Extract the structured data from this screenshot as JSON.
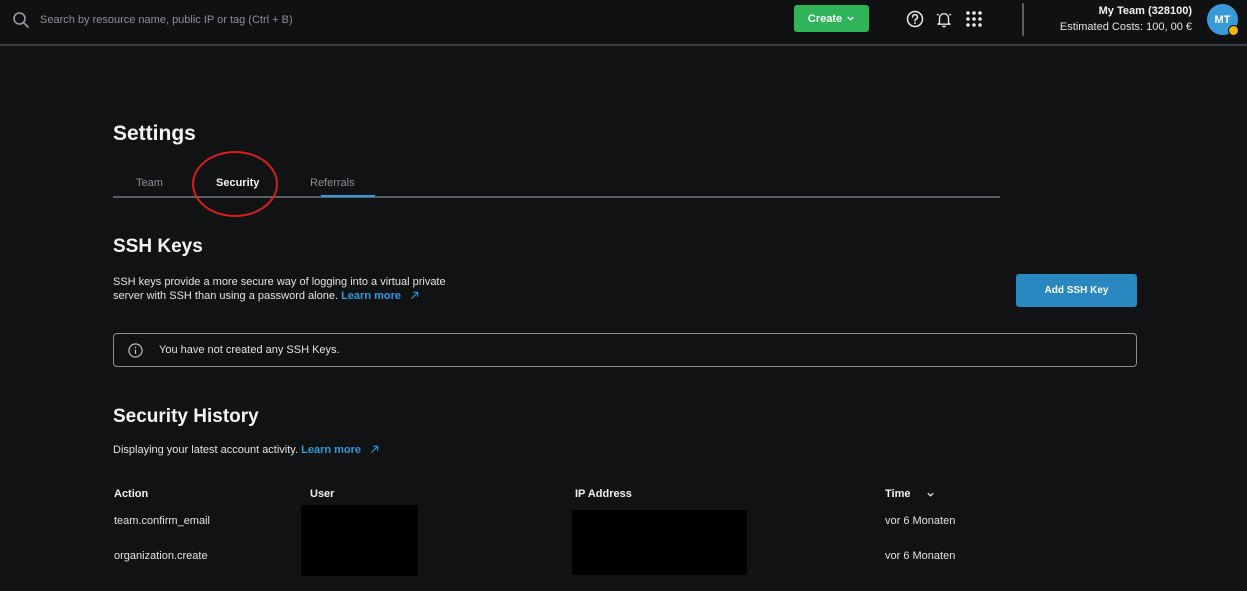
{
  "topbar": {
    "search_placeholder": "Search by resource name, public IP or tag (Ctrl + B)",
    "create_label": "Create",
    "icons": [
      "search-icon",
      "help-icon",
      "bell-icon",
      "apps-grid-icon",
      "chevron-down-icon"
    ],
    "team_name": "My Team (328100)",
    "estimated_costs": "Estimated Costs: 100, 00 €",
    "avatar_initials": "MT"
  },
  "settings": {
    "title": "Settings",
    "tabs": [
      {
        "label": "Team"
      },
      {
        "label": "Security"
      },
      {
        "label": "Referrals"
      }
    ],
    "active_tab": "Security"
  },
  "ssh": {
    "title": "SSH Keys",
    "description": "SSH keys provide a more secure way of logging into a virtual private server with SSH than using a password alone.",
    "learn_more": "Learn more",
    "add_button": "Add SSH Key",
    "empty_message": "You have not created any SSH Keys."
  },
  "security_history": {
    "title": "Security History",
    "description": "Displaying your latest account activity.",
    "learn_more": "Learn more",
    "columns": [
      "Action",
      "User",
      "IP Address",
      "Time"
    ],
    "rows": [
      {
        "action": "team.confirm_email",
        "time": "vor 6 Monaten"
      },
      {
        "action": "organization.create",
        "time": "vor 6 Monaten"
      }
    ]
  },
  "colors": {
    "background": "#111214",
    "accent_blue": "#2f9be0",
    "create_green": "#2fb45a",
    "annotation_red": "#d21f1f"
  }
}
